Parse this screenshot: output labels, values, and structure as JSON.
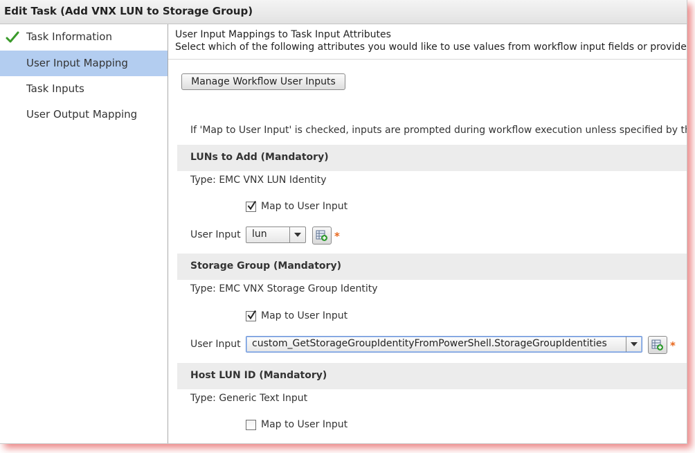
{
  "window": {
    "title": "Edit Task (Add VNX LUN to Storage Group)"
  },
  "sidebar": {
    "items": [
      {
        "label": "Task Information",
        "completed": true,
        "icon": "checkmark-icon"
      },
      {
        "label": "User Input Mapping",
        "active": true
      },
      {
        "label": "Task Inputs"
      },
      {
        "label": "User Output Mapping"
      }
    ]
  },
  "main": {
    "header_line1": "User Input Mappings to Task Input Attributes",
    "header_line2": "Select which of the following attributes you would like to use values from workflow input fields or provide",
    "manage_button": "Manage Workflow User Inputs",
    "note": "If 'Map to User Input' is checked, inputs are prompted during workflow execution unless specified by the",
    "required_marker": "*",
    "sections": [
      {
        "title": "LUNs to Add (Mandatory)",
        "type": "Type: EMC VNX LUN Identity",
        "map_label": "Map to User Input",
        "map_checked": true,
        "user_input_label": "User Input",
        "user_input_value": "lun"
      },
      {
        "title": "Storage Group (Mandatory)",
        "type": "Type: EMC VNX Storage Group Identity",
        "map_label": "Map to User Input",
        "map_checked": true,
        "user_input_label": "User Input",
        "user_input_value": "custom_GetStorageGroupIdentityFromPowerShell.StorageGroupIdentities"
      },
      {
        "title": "Host LUN ID (Mandatory)",
        "type": "Type: Generic Text Input",
        "map_label": "Map to User Input",
        "map_checked": false
      }
    ]
  },
  "colors": {
    "active_nav": "#b3cdf0",
    "section_header_bg": "#ececec",
    "required_asterisk": "#e8671c",
    "check_green": "#3a9a2a",
    "window_shadow": "#dc2828"
  }
}
